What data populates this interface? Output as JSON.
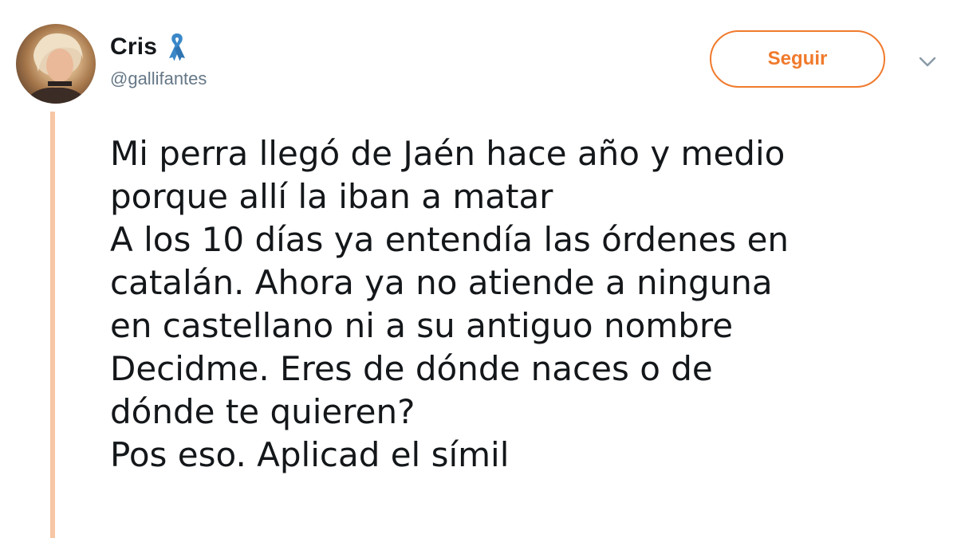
{
  "user": {
    "display_name": "Cris",
    "handle": "@gallifantes",
    "ribbon_color": "#3b88c9"
  },
  "actions": {
    "follow_label": "Seguir",
    "follow_color": "#f07a2c",
    "menu_icon": "chevron-down-icon"
  },
  "thread_line_color": "#f7c6a5",
  "tweet": {
    "lines": [
      "Mi perra llegó de Jaén hace año y medio",
      "porque allí la iban a matar",
      "A los 10 días ya entendía las órdenes en",
      "catalán. Ahora ya no atiende a ninguna",
      "en castellano ni a su antiguo nombre",
      "Decidme. Eres de dónde naces o de",
      "dónde te quieren?",
      "Pos eso. Aplicad el símil"
    ]
  }
}
